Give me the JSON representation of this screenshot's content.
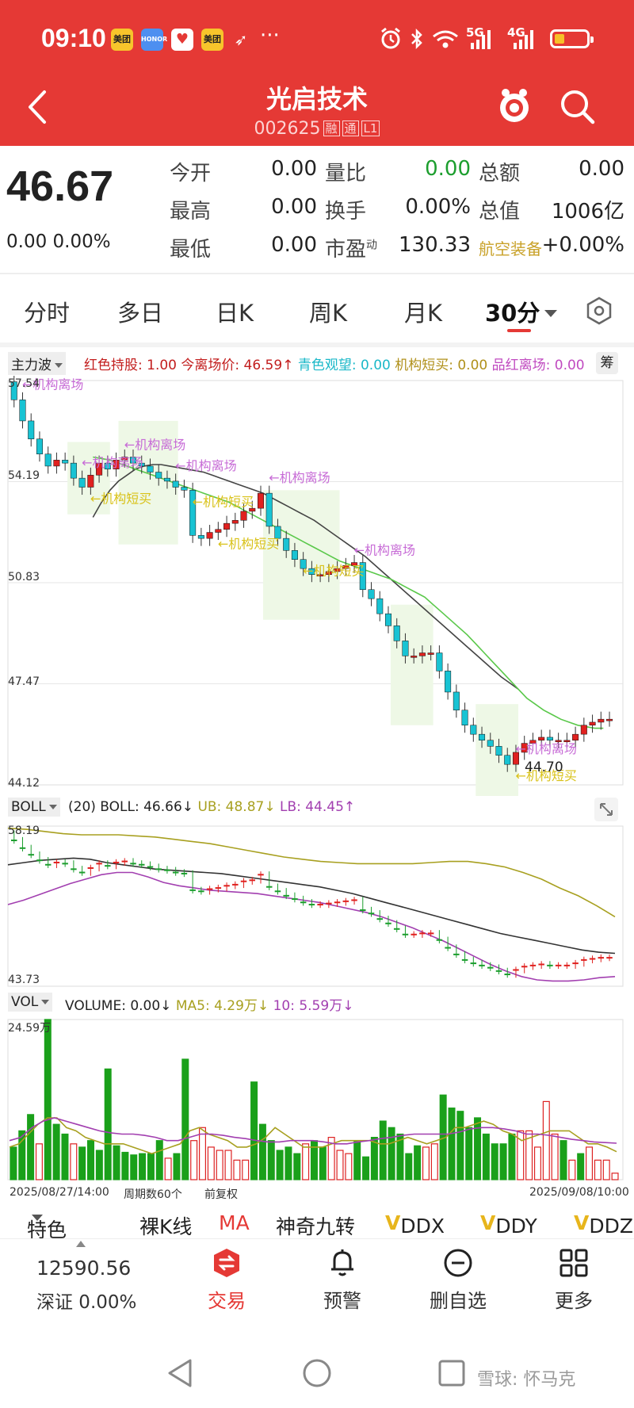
{
  "status_bar": {
    "time": "09:10",
    "apps": [
      "美团",
      "HONOR",
      "♥",
      "美团",
      "➶"
    ],
    "more": "···",
    "net1": "5G",
    "net2": "4G"
  },
  "header": {
    "title": "光启技术",
    "code": "002625",
    "tags": [
      "融",
      "通",
      "L1"
    ]
  },
  "quote": {
    "price": "46.67",
    "change": "0.00 0.00%",
    "fields": [
      {
        "label": "今开",
        "value": "0.00"
      },
      {
        "label": "量比",
        "value": "0.00"
      },
      {
        "label": "总额",
        "value": "0.00"
      },
      {
        "label": "最高",
        "value": "0.00"
      },
      {
        "label": "换手",
        "value": "0.00%"
      },
      {
        "label": "总值",
        "value": "1006亿"
      },
      {
        "label": "最低",
        "value": "0.00"
      },
      {
        "label": "市盈",
        "value": "130.33",
        "sup": "动"
      },
      {
        "label": "航空装备",
        "value": "+0.00%"
      }
    ]
  },
  "tabs": [
    "分时",
    "多日",
    "日K",
    "周K",
    "月K",
    "30分"
  ],
  "main_indicator": {
    "name": "主力波",
    "items": [
      {
        "text": "红色持股: 1.00",
        "color": "#c21d1d"
      },
      {
        "text": "今离场价: 46.59↑",
        "color": "#c21d1d"
      },
      {
        "text": "青色观望: 0.00",
        "color": "#1ab8c8"
      },
      {
        "text": "机构短买: 0.00",
        "color": "#b0901a"
      },
      {
        "text": "品红离场: 0.00",
        "color": "#c04ac0"
      }
    ],
    "side_btn": "筹"
  },
  "boll": {
    "name": "BOLL",
    "items": [
      {
        "text": "(20) BOLL: 46.66↓",
        "color": "#222"
      },
      {
        "text": "UB: 48.87↓",
        "color": "#a8a020"
      },
      {
        "text": "LB: 44.45↑",
        "color": "#a23fb0"
      }
    ]
  },
  "vol": {
    "name": "VOL",
    "items": [
      {
        "text": "VOLUME: 0.00↓",
        "color": "#222"
      },
      {
        "text": "MA5: 4.29万↓",
        "color": "#a8a020"
      },
      {
        "text": "10: 5.59万↓",
        "color": "#a23fb0"
      }
    ]
  },
  "chart_data": [
    {
      "type": "candlestick",
      "title": "主力波",
      "y_ticks": [
        "57.54",
        "54.19",
        "50.83",
        "47.47",
        "44.12"
      ],
      "ylim": [
        44.12,
        57.54
      ],
      "min_label": "44.70",
      "annotations": [
        "机构离场",
        "机构短买"
      ],
      "annotation_text": {
        "exit": "机构离场",
        "buy": "机构短买"
      },
      "close": [
        56.9,
        56.2,
        55.6,
        55.1,
        54.7,
        54.9,
        54.8,
        54.3,
        54.0,
        54.4,
        54.8,
        54.6,
        54.9,
        55.0,
        54.8,
        54.7,
        54.5,
        54.3,
        54.2,
        54.0,
        53.9,
        52.4,
        52.3,
        52.5,
        52.6,
        52.8,
        52.9,
        53.2,
        53.3,
        53.8,
        52.7,
        52.3,
        51.9,
        51.6,
        51.3,
        51.1,
        51.1,
        51.2,
        51.3,
        51.4,
        51.5,
        50.6,
        50.3,
        49.8,
        49.4,
        48.9,
        48.4,
        48.4,
        48.5,
        48.5,
        47.9,
        47.2,
        46.6,
        46.1,
        45.8,
        45.6,
        45.4,
        45.1,
        44.8,
        45.2,
        45.5,
        45.6,
        45.7,
        45.6,
        45.6,
        45.6,
        45.8,
        46.1,
        46.2,
        46.3,
        46.3
      ],
      "ma_green": [
        55.0,
        54.95,
        54.9,
        54.8,
        54.7,
        54.6,
        54.5,
        54.4,
        54.3,
        54.2,
        54.1,
        54.0,
        53.9,
        53.8,
        53.7,
        53.6,
        53.5,
        53.35,
        53.2,
        53.05,
        52.9,
        52.75,
        52.6,
        52.45,
        52.3,
        52.15,
        52.0,
        51.85,
        51.7,
        51.55,
        51.45,
        51.35,
        51.25,
        51.15,
        51.05,
        50.95,
        50.8,
        50.65,
        50.5,
        50.35,
        50.1,
        49.85,
        49.6,
        49.35,
        49.1,
        48.8,
        48.5,
        48.2,
        47.9,
        47.6,
        47.3,
        47.0,
        46.8,
        46.6,
        46.45,
        46.3,
        46.2,
        46.1,
        46.05,
        46.0,
        46.0
      ],
      "ma_dark": [
        53.0,
        53.5,
        53.9,
        54.2,
        54.4,
        54.6,
        54.7,
        54.75,
        54.75,
        54.7,
        54.65,
        54.6,
        54.55,
        54.5,
        54.4,
        54.3,
        54.2,
        54.1,
        54.0,
        53.9,
        53.8,
        53.65,
        53.5,
        53.35,
        53.2,
        53.05,
        52.9,
        52.7,
        52.5,
        52.3,
        52.1,
        51.9,
        51.7,
        51.45,
        51.2,
        50.95,
        50.7,
        50.45,
        50.2,
        49.95,
        49.7,
        49.45,
        49.2,
        48.95,
        48.7,
        48.45,
        48.2,
        47.95,
        47.7,
        47.5,
        47.3
      ]
    },
    {
      "type": "line",
      "title": "BOLL",
      "y_ticks": [
        "58.19",
        "43.73"
      ],
      "ylim": [
        43.73,
        58.19
      ],
      "series": [
        {
          "name": "UB",
          "values": [
            58.0,
            57.9,
            57.7,
            57.5,
            57.4,
            57.4,
            57.4,
            57.3,
            57.2,
            57.0,
            56.8,
            56.6,
            56.3,
            56.0,
            55.7,
            55.4,
            55.2,
            55.0,
            54.9,
            54.8,
            54.8,
            54.8,
            54.8,
            54.9,
            55.0,
            55.0,
            54.8,
            54.5,
            54.0,
            53.4,
            52.6,
            51.9,
            51.0,
            50.0
          ]
        },
        {
          "name": "BOLL",
          "values": [
            54.7,
            54.9,
            55.1,
            55.2,
            55.3,
            55.2,
            54.9,
            54.7,
            54.5,
            54.3,
            54.2,
            54.1,
            54.0,
            53.9,
            53.7,
            53.5,
            53.3,
            53.1,
            52.9,
            52.7,
            52.4,
            52.1,
            51.7,
            51.3,
            50.9,
            50.5,
            50.1,
            49.7,
            49.3,
            48.9,
            48.5,
            48.2,
            47.9,
            47.6,
            47.3,
            47.0,
            46.8,
            46.7
          ]
        },
        {
          "name": "LB",
          "values": [
            51.1,
            51.5,
            52.0,
            52.5,
            53.0,
            53.4,
            53.8,
            54.0,
            54.0,
            53.6,
            53.1,
            52.8,
            52.6,
            52.4,
            52.3,
            52.2,
            52.1,
            51.9,
            51.7,
            51.5,
            51.3,
            51.0,
            50.7,
            50.4,
            50.0,
            49.5,
            49.0,
            48.4,
            47.8,
            47.1,
            46.4,
            45.7,
            45.1,
            44.6,
            44.3,
            44.2,
            44.2,
            44.3,
            44.5,
            44.6
          ]
        }
      ]
    },
    {
      "type": "bar",
      "title": "VOL",
      "y_ticks": [
        "24.59万"
      ],
      "ylim": [
        0,
        24.59
      ],
      "x_labels": [
        "2025/08/27/14:00",
        "周期数60个",
        "前复权",
        "2025/09/08/10:00"
      ],
      "values": [
        5.0,
        7.5,
        10.0,
        5.5,
        24.6,
        8.5,
        7.0,
        5.5,
        5.0,
        6.0,
        4.5,
        17.0,
        5.2,
        4.2,
        3.8,
        4.0,
        4.0,
        6.0,
        3.3,
        4.0,
        18.5,
        6.0,
        8.0,
        5.0,
        4.5,
        4.5,
        3.0,
        3.0,
        15.0,
        8.5,
        6.0,
        4.5,
        5.0,
        4.0,
        5.5,
        6.0,
        5.0,
        6.5,
        4.5,
        4.0,
        6.0,
        3.5,
        6.5,
        9.0,
        8.0,
        7.0,
        4.0,
        5.2,
        5.0,
        5.5,
        13.0,
        11.0,
        10.5,
        8.0,
        9.5,
        7.0,
        5.5,
        5.5,
        7.0,
        7.5,
        7.5,
        5.0,
        12.0,
        7.0,
        6.0,
        3.0,
        4.0,
        5.0,
        3.0,
        3.0,
        1.0
      ],
      "up": [
        false,
        false,
        false,
        true,
        false,
        false,
        false,
        true,
        false,
        false,
        false,
        false,
        false,
        false,
        false,
        false,
        false,
        false,
        true,
        false,
        false,
        true,
        true,
        true,
        true,
        true,
        true,
        true,
        false,
        false,
        false,
        false,
        false,
        false,
        true,
        false,
        false,
        true,
        true,
        true,
        false,
        false,
        false,
        false,
        false,
        false,
        false,
        false,
        true,
        true,
        false,
        false,
        false,
        false,
        false,
        false,
        false,
        false,
        false,
        true,
        true,
        true,
        true,
        true,
        false,
        true,
        false,
        true,
        true,
        true,
        true
      ],
      "ma5": [
        5.0,
        5.5,
        7.0,
        8.5,
        9.5,
        9.5,
        8.0,
        7.5,
        6.5,
        6.0,
        5.5,
        5.5,
        5.5,
        5.0,
        4.5,
        4.0,
        4.5,
        5.0,
        5.5,
        7.5,
        8.0,
        7.0,
        6.5,
        6.0,
        5.0,
        5.0,
        5.5,
        6.5,
        8.0,
        7.0,
        6.0,
        5.0,
        5.0,
        5.0,
        5.5,
        6.0,
        6.0,
        6.0,
        6.0,
        5.5,
        5.5,
        6.0,
        6.5,
        6.0,
        5.5,
        6.0,
        6.5,
        8.0,
        8.0,
        8.5,
        9.0,
        8.5,
        7.5,
        7.0,
        6.0,
        6.5,
        7.0,
        7.5,
        7.5,
        7.5,
        6.5,
        5.5,
        5.5,
        5.0,
        4.3
      ],
      "ma10": [
        6.0,
        6.5,
        8.0,
        9.0,
        9.5,
        9.0,
        8.5,
        8.0,
        7.5,
        7.2,
        7.0,
        7.0,
        6.8,
        6.5,
        6.0,
        6.0,
        6.5,
        7.0,
        7.0,
        6.8,
        6.5,
        6.3,
        6.0,
        5.8,
        5.8,
        6.0,
        6.0,
        6.0,
        5.8,
        5.5,
        5.5,
        5.8,
        6.0,
        6.3,
        6.5,
        6.8,
        7.0,
        7.0,
        7.0,
        7.0,
        7.3,
        7.8,
        8.0,
        8.0,
        7.8,
        7.5,
        7.0,
        7.0,
        6.8,
        6.5,
        6.2,
        6.0,
        5.8,
        5.7,
        5.6
      ]
    }
  ],
  "feature_bar": [
    "特色",
    "裸K线",
    "MA",
    "神奇九转",
    "DDX",
    "DDY",
    "DDZ"
  ],
  "feature_prefix": "V",
  "bottom_nav": {
    "index_value": "12590.56",
    "index_name": "深证 0.00%",
    "items": [
      "交易",
      "预警",
      "删自选",
      "更多"
    ]
  },
  "watermark": "雪球: 怀马克"
}
